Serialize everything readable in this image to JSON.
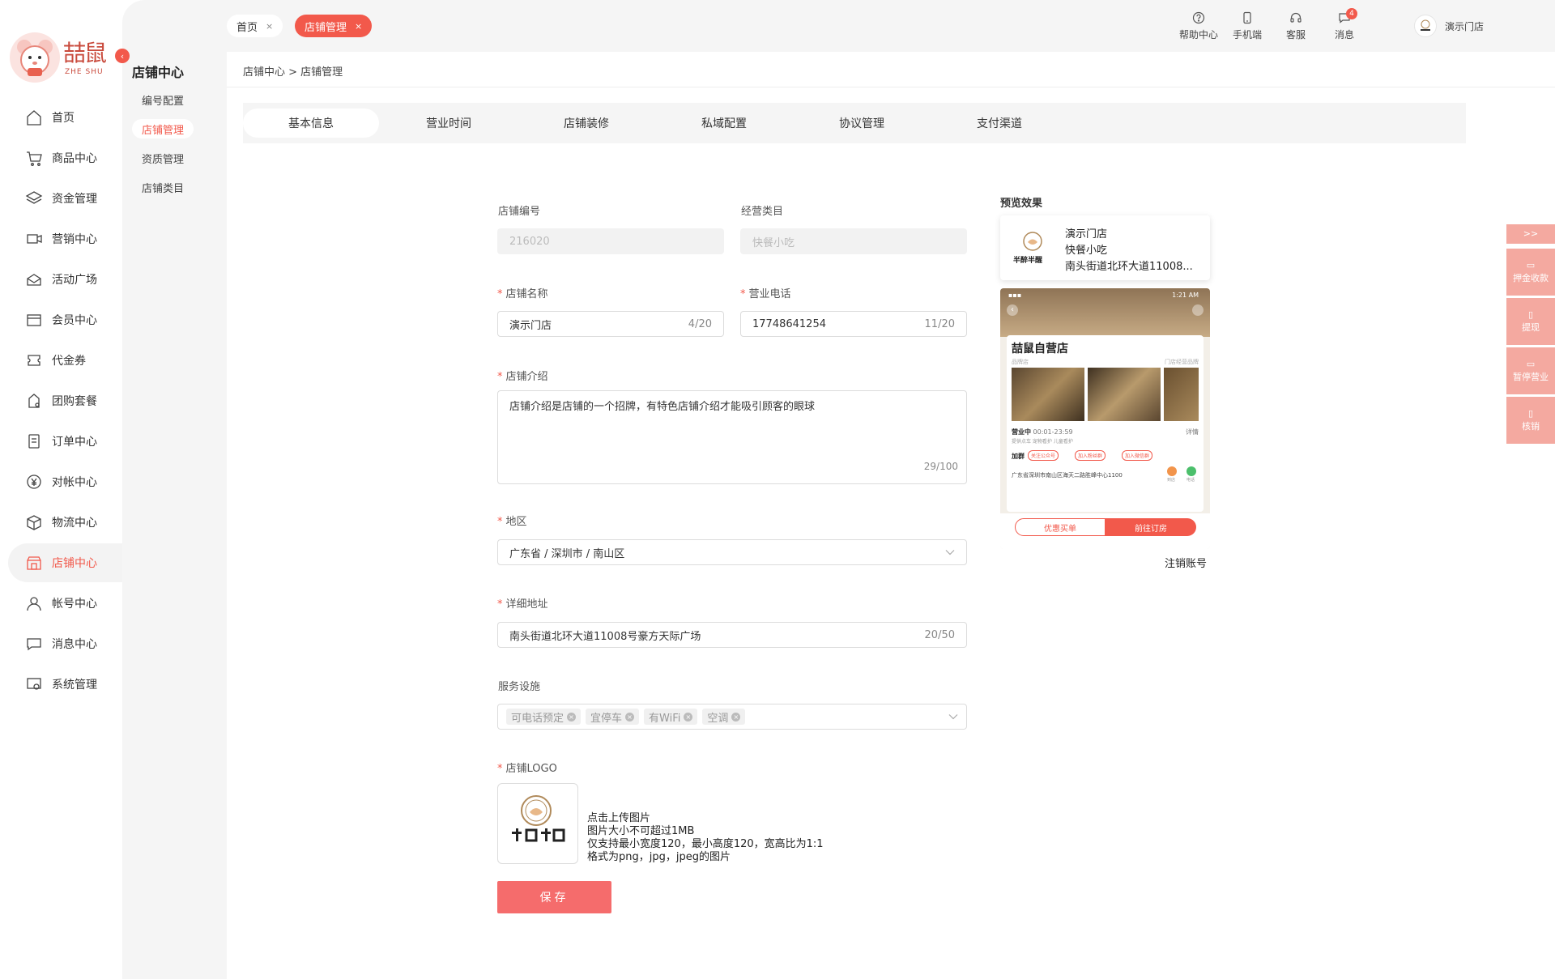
{
  "brand": {
    "logo_text": "喆鼠",
    "logo_sub": "ZHE SHU"
  },
  "nav": [
    {
      "label": "首页",
      "icon": "home-icon",
      "name": "home"
    },
    {
      "label": "商品中心",
      "icon": "cart-icon",
      "name": "products"
    },
    {
      "label": "资金管理",
      "icon": "layers-icon",
      "name": "funds"
    },
    {
      "label": "营销中心",
      "icon": "marketing-icon",
      "name": "marketing"
    },
    {
      "label": "活动广场",
      "icon": "activity-icon",
      "name": "activity"
    },
    {
      "label": "会员中心",
      "icon": "vip-icon",
      "name": "members"
    },
    {
      "label": "代金券",
      "icon": "coupon-icon",
      "name": "coupons"
    },
    {
      "label": "团购套餐",
      "icon": "group-buy-icon",
      "name": "group-buy"
    },
    {
      "label": "订单中心",
      "icon": "order-icon",
      "name": "orders"
    },
    {
      "label": "对帐中心",
      "icon": "yen-icon",
      "name": "reconciliation"
    },
    {
      "label": "物流中心",
      "icon": "box-icon",
      "name": "logistics"
    },
    {
      "label": "店铺中心",
      "icon": "store-icon",
      "name": "store",
      "active": true
    },
    {
      "label": "帐号中心",
      "icon": "user-icon",
      "name": "account"
    },
    {
      "label": "消息中心",
      "icon": "chat-icon",
      "name": "messages"
    },
    {
      "label": "系统管理",
      "icon": "system-icon",
      "name": "system"
    }
  ],
  "submenu": {
    "title": "店铺中心",
    "collapse_icon": "chevron-left-icon",
    "items": [
      {
        "label": "编号配置"
      },
      {
        "label": "店铺管理",
        "active": true
      },
      {
        "label": "资质管理"
      },
      {
        "label": "店铺类目"
      }
    ]
  },
  "top_tabs": [
    {
      "label": "首页",
      "close": "×"
    },
    {
      "label": "店铺管理",
      "close": "×"
    }
  ],
  "top_icons": [
    {
      "label": "帮助中心",
      "icon": "help-icon"
    },
    {
      "label": "手机端",
      "icon": "mobile-icon"
    },
    {
      "label": "客服",
      "icon": "headset-icon"
    },
    {
      "label": "消息",
      "icon": "message-icon",
      "badge": "4"
    }
  ],
  "user": {
    "name": "演示门店"
  },
  "breadcrumb": "店铺中心 > 店铺管理",
  "section_tabs": [
    "基本信息",
    "营业时间",
    "店铺装修",
    "私域配置",
    "协议管理",
    "支付渠道"
  ],
  "form": {
    "required_mark": "*",
    "store_no": {
      "label": "店铺编号",
      "value": "216020"
    },
    "category": {
      "label": "经营类目",
      "value": "快餐小吃"
    },
    "store_name": {
      "label": "店铺名称",
      "value": "演示门店",
      "count": "4/20"
    },
    "phone": {
      "label": "营业电话",
      "value": "17748641254",
      "count": "11/20"
    },
    "intro": {
      "label": "店铺介绍",
      "value": "店铺介绍是店铺的一个招牌，有特色店铺介绍才能吸引顾客的眼球",
      "count": "29/100"
    },
    "region": {
      "label": "地区",
      "value": "广东省 / 深圳市 / 南山区"
    },
    "address": {
      "label": "详细地址",
      "value": "南头街道北环大道11008号豪方天际广场",
      "count": "20/50"
    },
    "facilities": {
      "label": "服务设施",
      "tags": [
        "可电话预定",
        "宜停车",
        "有WiFi",
        "空调"
      ]
    },
    "logo": {
      "label": "店铺LOGO",
      "tips": [
        "点击上传图片",
        "图片大小不可超过1MB",
        "仅支持最小宽度120，最小高度120，宽高比为1:1",
        "格式为png，jpg，jpeg的图片"
      ]
    },
    "save_label": "保存"
  },
  "preview": {
    "title": "预览效果",
    "card_lines": [
      "演示门店",
      "快餐小吃",
      "南头街道北环大道11008..."
    ],
    "logo_text": "半醉半醒",
    "phone": {
      "time": "1:21 AM",
      "store_name": "喆鼠自营店",
      "brand_tag": "品牌店",
      "franchise_tag": "门店经营品牌",
      "open_status": "营业中",
      "hours": "00:01-23:59",
      "detail": "详情",
      "services": "提供点车  宠物看护  儿童看护",
      "follow_label": "加群",
      "follow_tags": [
        "关注公众号",
        "加入粉丝群",
        "加入微信群"
      ],
      "address": "广东省深圳市南山区海天二路胜峰中心1100",
      "nav_label": "到店",
      "call_label": "电话",
      "btn_left": "优惠买单",
      "btn_right": "前往订房"
    },
    "cancel": "注销账号"
  },
  "float_panel": [
    {
      "label": ">>",
      "name": "expand"
    },
    {
      "label": "押金收款",
      "name": "deposit"
    },
    {
      "label": "提现",
      "name": "withdraw"
    },
    {
      "label": "暂停营业",
      "name": "pause-business"
    },
    {
      "label": "核销",
      "name": "verify"
    }
  ],
  "colors": {
    "accent": "#f2594b",
    "float": "#f4a9a0"
  }
}
